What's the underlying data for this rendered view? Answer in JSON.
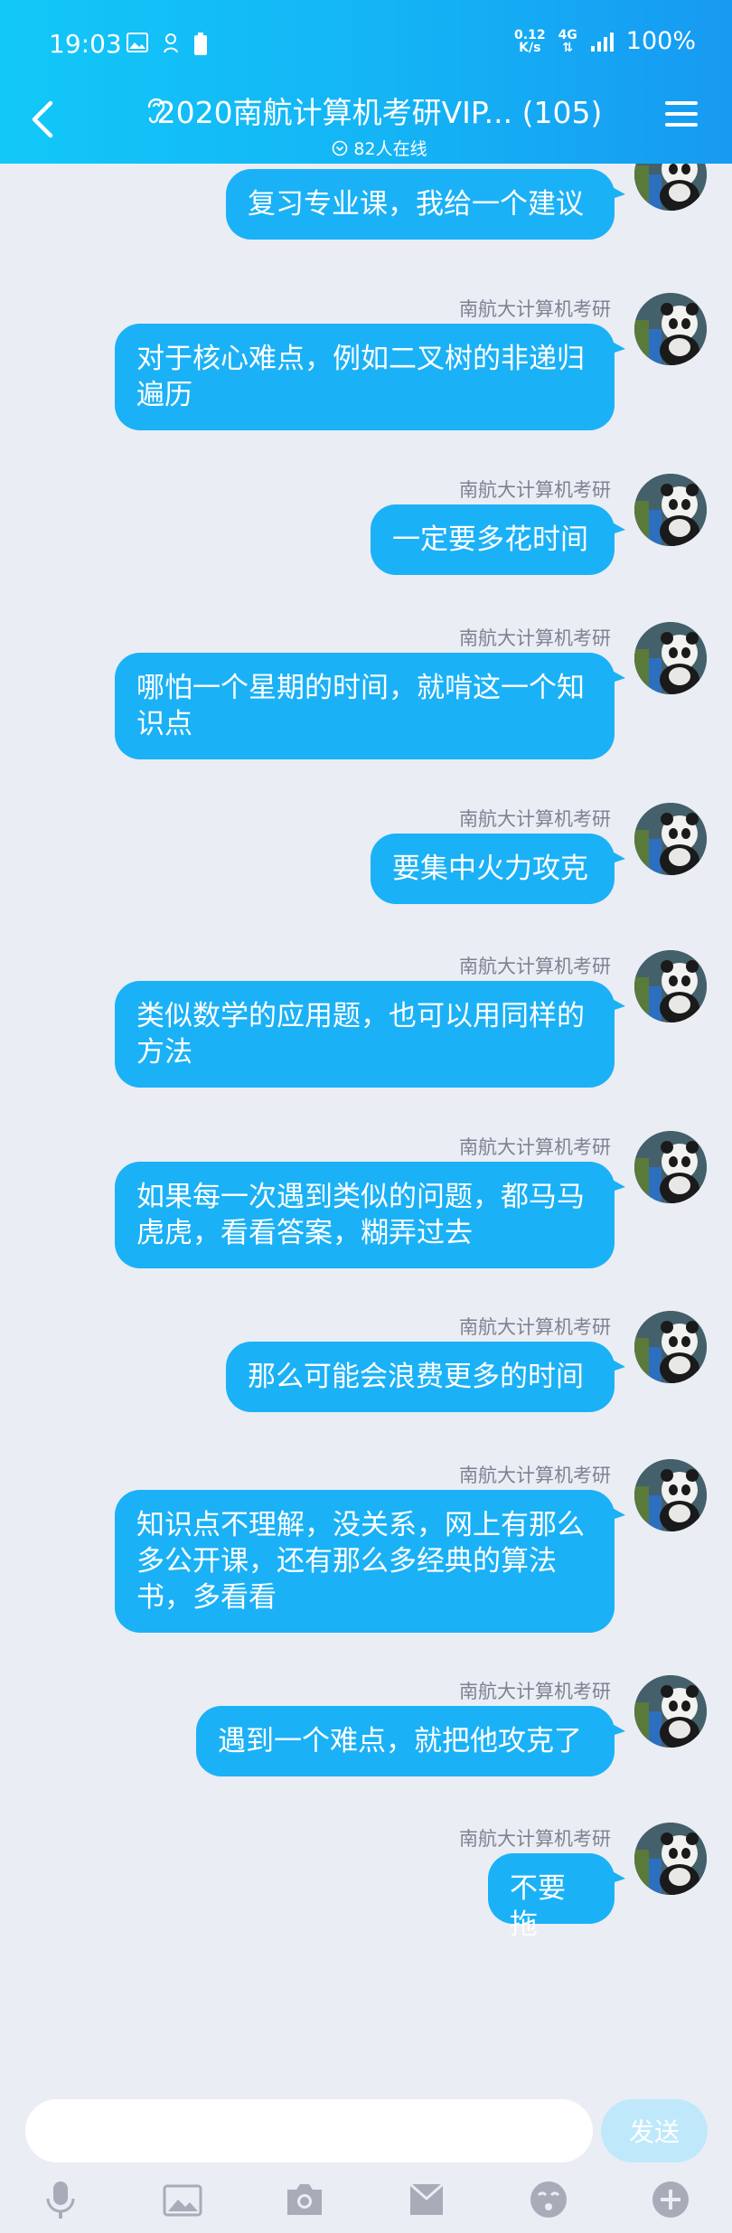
{
  "status_bar": {
    "time": "19:03",
    "speed_value": "0.12",
    "speed_unit": "K/s",
    "network": "4G",
    "battery": "100%"
  },
  "header": {
    "title": "2020南航计算机考研VIP... (105)",
    "online": "82人在线",
    "accent_color": "#14b3f5"
  },
  "messages": [
    {
      "sender": "南航大计算机考研",
      "text": "复习专业课，我给一个建议"
    },
    {
      "sender": "南航大计算机考研",
      "text": "对于核心难点，例如二叉树的非递归遍历"
    },
    {
      "sender": "南航大计算机考研",
      "text": "一定要多花时间"
    },
    {
      "sender": "南航大计算机考研",
      "text": "哪怕一个星期的时间，就啃这一个知识点"
    },
    {
      "sender": "南航大计算机考研",
      "text": "要集中火力攻克"
    },
    {
      "sender": "南航大计算机考研",
      "text": "类似数学的应用题，也可以用同样的方法"
    },
    {
      "sender": "南航大计算机考研",
      "text": "如果每一次遇到类似的问题，都马马虎虎，看看答案，糊弄过去"
    },
    {
      "sender": "南航大计算机考研",
      "text": "那么可能会浪费更多的时间"
    },
    {
      "sender": "南航大计算机考研",
      "text": "知识点不理解，没关系，网上有那么多公开课，还有那么多经典的算法书，多看看"
    },
    {
      "sender": "南航大计算机考研",
      "text": "遇到一个难点，就把他攻克了"
    },
    {
      "sender": "南航大计算机考研",
      "text": "不要拖"
    }
  ],
  "input": {
    "value": "",
    "placeholder": "",
    "send_label": "发送"
  },
  "toolbar": [
    "mic-icon",
    "image-icon",
    "camera-icon",
    "envelope-icon",
    "emoji-icon",
    "plus-icon"
  ]
}
